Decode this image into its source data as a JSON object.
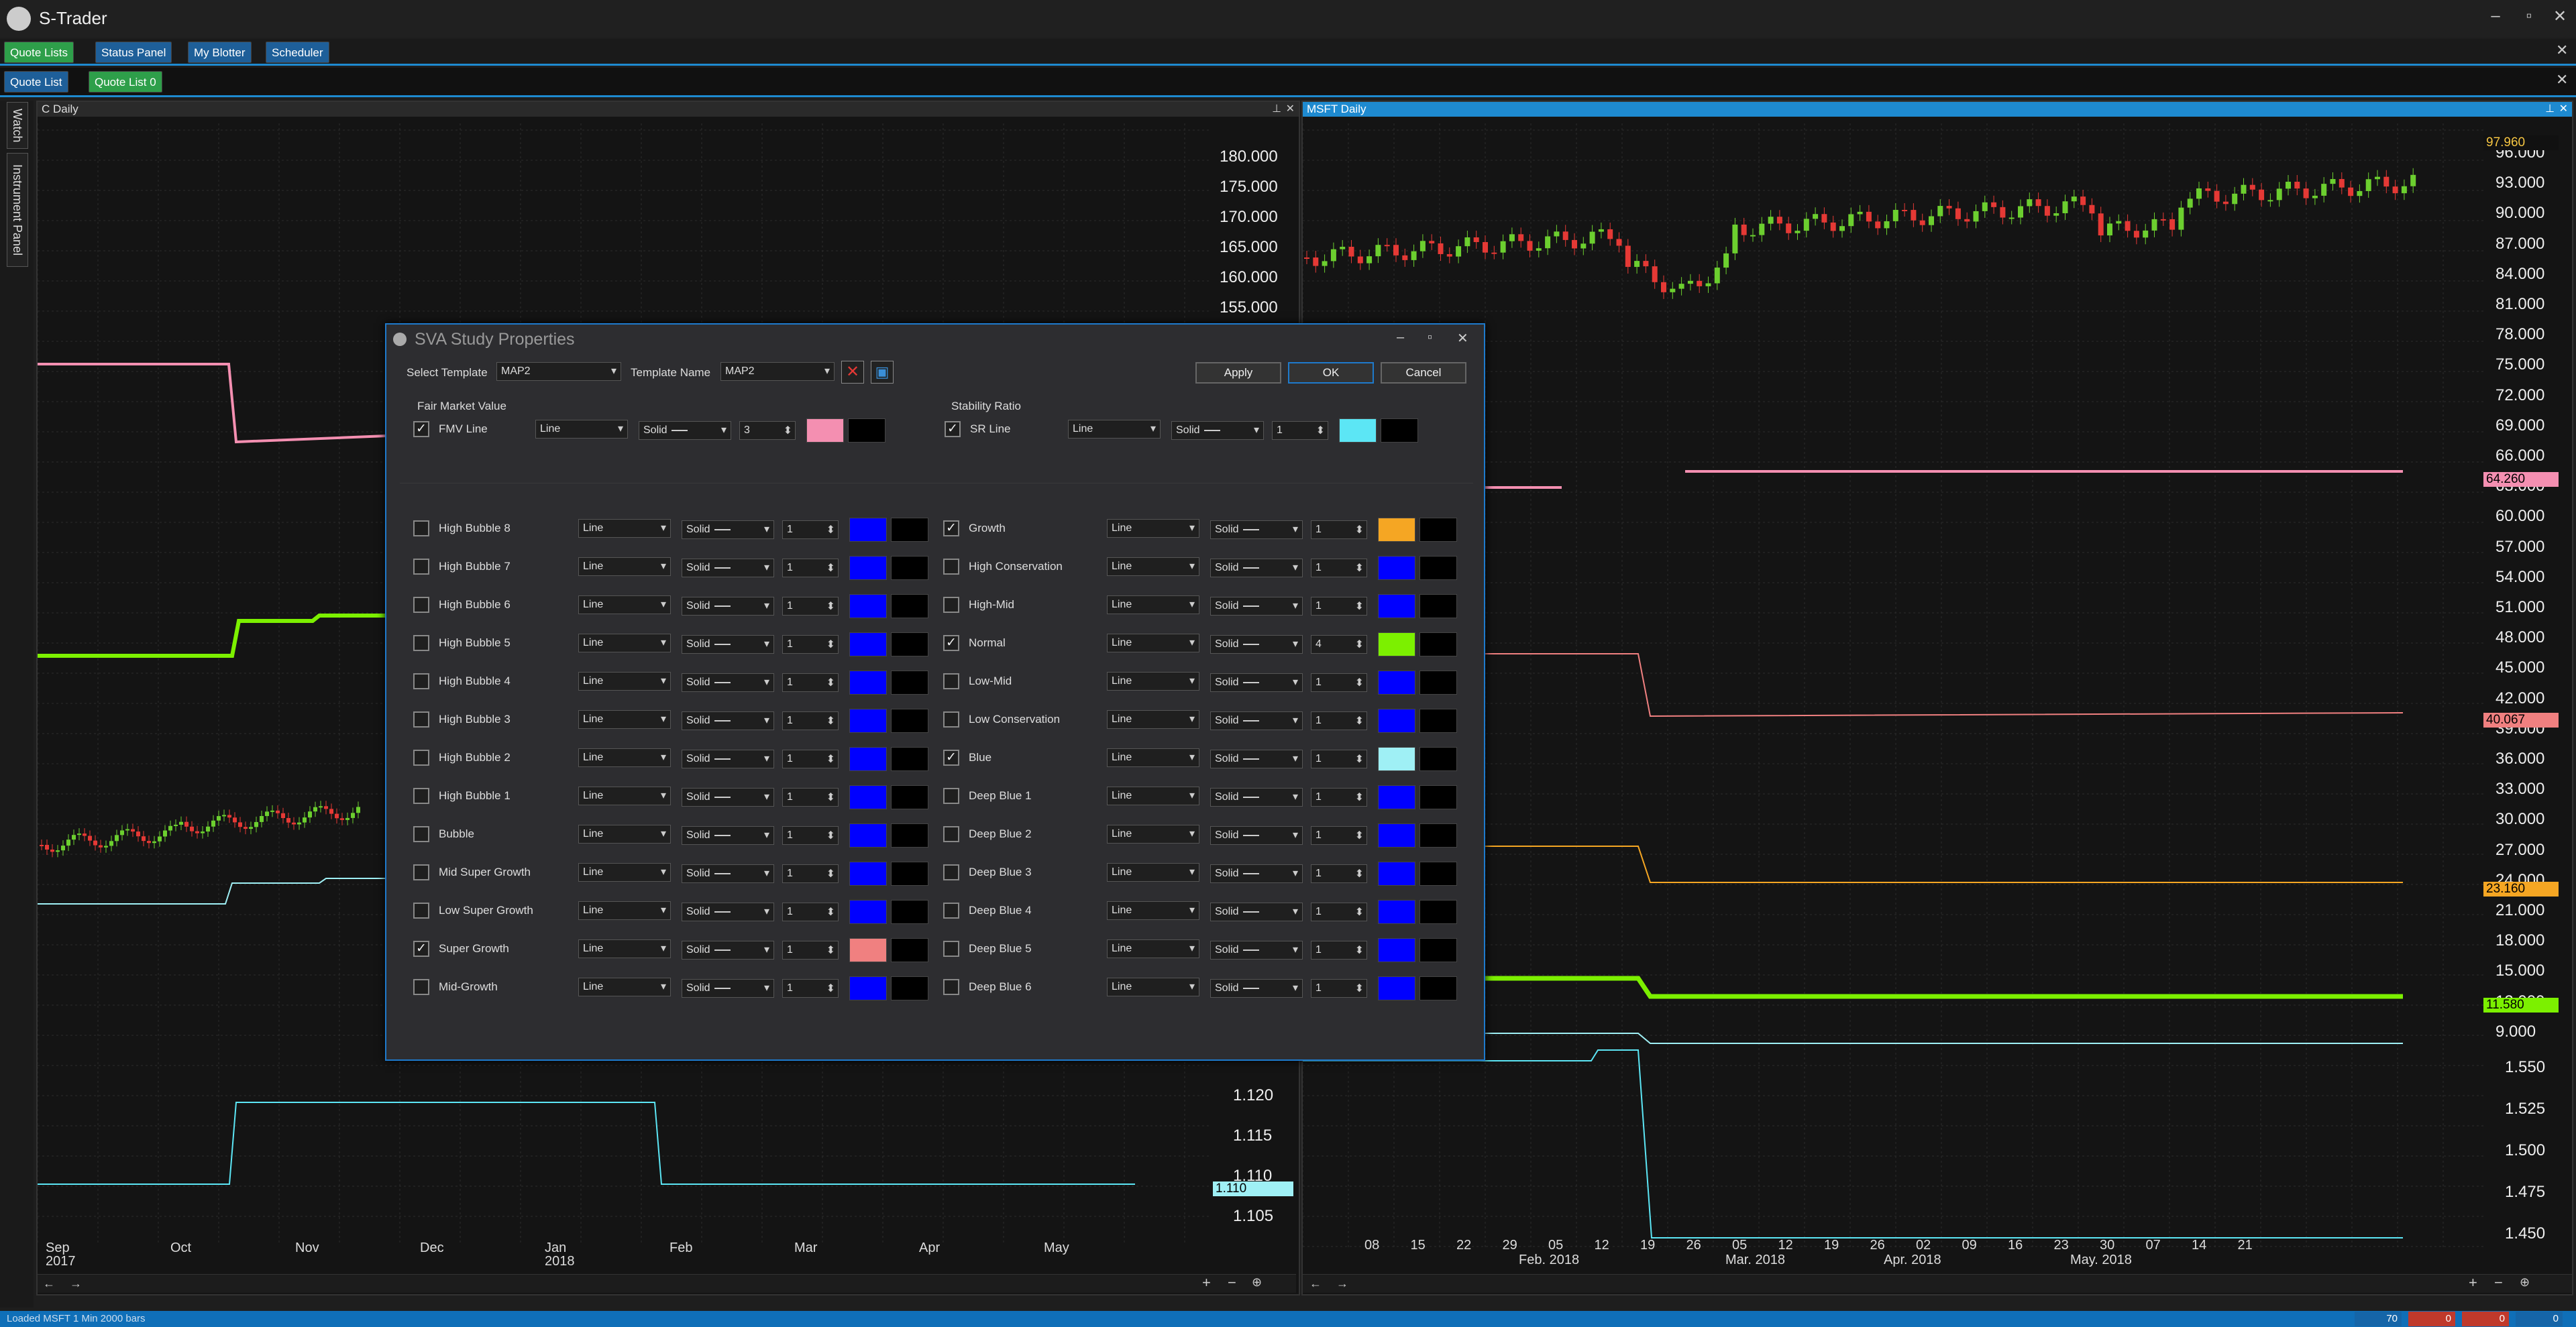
{
  "app": {
    "title": "S-Trader"
  },
  "toolbar": {
    "tabs": [
      "Quote Lists",
      "Status Panel",
      "My Blotter",
      "Scheduler"
    ]
  },
  "subtabs": [
    "Quote List",
    "Quote List 0"
  ],
  "sidebar": [
    "Watch",
    "Instrument Panel"
  ],
  "left_pane": {
    "title": "C Daily",
    "y_upper": [
      "180.000",
      "175.000",
      "170.000",
      "165.000",
      "160.000",
      "155.000"
    ],
    "y_lower": [
      "1.120",
      "1.115",
      "1.110",
      "1.105"
    ],
    "price_tag": "1.110",
    "x_months": [
      {
        "m": "Sep",
        "y": "2017"
      },
      {
        "m": "Oct",
        "y": ""
      },
      {
        "m": "Nov",
        "y": ""
      },
      {
        "m": "Dec",
        "y": ""
      },
      {
        "m": "Jan",
        "y": "2018"
      },
      {
        "m": "Feb",
        "y": ""
      },
      {
        "m": "Mar",
        "y": ""
      },
      {
        "m": "Apr",
        "y": ""
      },
      {
        "m": "May",
        "y": ""
      }
    ]
  },
  "right_pane": {
    "title": "MSFT Daily",
    "y_upper": [
      "96.000",
      "93.000",
      "90.000",
      "87.000",
      "84.000",
      "81.000",
      "78.000",
      "75.000",
      "72.000",
      "69.000",
      "66.000",
      "63.000",
      "60.000",
      "57.000",
      "54.000",
      "51.000",
      "48.000",
      "45.000",
      "42.000",
      "39.000",
      "36.000",
      "33.000",
      "30.000",
      "27.000",
      "24.000",
      "21.000",
      "18.000",
      "15.000",
      "12.000",
      "9.000"
    ],
    "y_lower": [
      "1.550",
      "1.525",
      "1.500",
      "1.475",
      "1.450"
    ],
    "tags": {
      "price": "97.960",
      "pink": "64.260",
      "salmon": "40.067",
      "orange": "23.160",
      "green": "11.580"
    },
    "x_days": [
      "08",
      "15",
      "22",
      "29",
      "05",
      "12",
      "19",
      "26",
      "05",
      "12",
      "19",
      "26",
      "02",
      "09",
      "16",
      "23",
      "30",
      "07",
      "14",
      "21"
    ],
    "x_months": [
      "Feb. 2018",
      "Mar. 2018",
      "Apr. 2018",
      "May. 2018"
    ]
  },
  "status": {
    "text": "Loaded MSFT 1 Min 2000 bars",
    "counters": [
      "70",
      "0",
      "0",
      "0"
    ]
  },
  "dialog": {
    "title": "SVA Study Properties",
    "select_template_label": "Select Template",
    "select_template_value": "MAP2",
    "template_name_label": "Template Name",
    "template_name_value": "MAP2",
    "apply": "Apply",
    "ok": "OK",
    "cancel": "Cancel",
    "fmv_header": "Fair Market Value",
    "sr_header": "Stability Ratio",
    "fmv": {
      "label": "FMV Line",
      "checked": true,
      "type": "Line",
      "style": "Solid",
      "width": "3",
      "color": "#f48fb1"
    },
    "sr": {
      "label": "SR Line",
      "checked": true,
      "type": "Line",
      "style": "Solid",
      "width": "1",
      "color": "#5ce6f5"
    },
    "left_rows": [
      {
        "label": "High Bubble 8",
        "checked": false,
        "type": "Line",
        "style": "Solid",
        "width": "1",
        "color": "#0000ff"
      },
      {
        "label": "High Bubble 7",
        "checked": false,
        "type": "Line",
        "style": "Solid",
        "width": "1",
        "color": "#0000ff"
      },
      {
        "label": "High Bubble 6",
        "checked": false,
        "type": "Line",
        "style": "Solid",
        "width": "1",
        "color": "#0000ff"
      },
      {
        "label": "High Bubble 5",
        "checked": false,
        "type": "Line",
        "style": "Solid",
        "width": "1",
        "color": "#0000ff"
      },
      {
        "label": "High Bubble 4",
        "checked": false,
        "type": "Line",
        "style": "Solid",
        "width": "1",
        "color": "#0000ff"
      },
      {
        "label": "High Bubble 3",
        "checked": false,
        "type": "Line",
        "style": "Solid",
        "width": "1",
        "color": "#0000ff"
      },
      {
        "label": "High Bubble 2",
        "checked": false,
        "type": "Line",
        "style": "Solid",
        "width": "1",
        "color": "#0000ff"
      },
      {
        "label": "High Bubble 1",
        "checked": false,
        "type": "Line",
        "style": "Solid",
        "width": "1",
        "color": "#0000ff"
      },
      {
        "label": "Bubble",
        "checked": false,
        "type": "Line",
        "style": "Solid",
        "width": "1",
        "color": "#0000ff"
      },
      {
        "label": "Mid Super Growth",
        "checked": false,
        "type": "Line",
        "style": "Solid",
        "width": "1",
        "color": "#0000ff"
      },
      {
        "label": "Low Super Growth",
        "checked": false,
        "type": "Line",
        "style": "Solid",
        "width": "1",
        "color": "#0000ff"
      },
      {
        "label": "Super Growth",
        "checked": true,
        "type": "Line",
        "style": "Solid",
        "width": "1",
        "color": "#f08080"
      },
      {
        "label": "Mid-Growth",
        "checked": false,
        "type": "Line",
        "style": "Solid",
        "width": "1",
        "color": "#0000ff"
      }
    ],
    "right_rows": [
      {
        "label": "Growth",
        "checked": true,
        "type": "Line",
        "style": "Solid",
        "width": "1",
        "color": "#f5a623"
      },
      {
        "label": "High Conservation",
        "checked": false,
        "type": "Line",
        "style": "Solid",
        "width": "1",
        "color": "#0000ff"
      },
      {
        "label": "High-Mid",
        "checked": false,
        "type": "Line",
        "style": "Solid",
        "width": "1",
        "color": "#0000ff"
      },
      {
        "label": "Normal",
        "checked": true,
        "type": "Line",
        "style": "Solid",
        "width": "4",
        "color": "#7cf000"
      },
      {
        "label": "Low-Mid",
        "checked": false,
        "type": "Line",
        "style": "Solid",
        "width": "1",
        "color": "#0000ff"
      },
      {
        "label": "Low Conservation",
        "checked": false,
        "type": "Line",
        "style": "Solid",
        "width": "1",
        "color": "#0000ff"
      },
      {
        "label": "Blue",
        "checked": true,
        "type": "Line",
        "style": "Solid",
        "width": "1",
        "color": "#9ff0f5"
      },
      {
        "label": "Deep Blue 1",
        "checked": false,
        "type": "Line",
        "style": "Solid",
        "width": "1",
        "color": "#0000ff"
      },
      {
        "label": "Deep Blue 2",
        "checked": false,
        "type": "Line",
        "style": "Solid",
        "width": "1",
        "color": "#0000ff"
      },
      {
        "label": "Deep Blue 3",
        "checked": false,
        "type": "Line",
        "style": "Solid",
        "width": "1",
        "color": "#0000ff"
      },
      {
        "label": "Deep Blue 4",
        "checked": false,
        "type": "Line",
        "style": "Solid",
        "width": "1",
        "color": "#0000ff"
      },
      {
        "label": "Deep Blue 5",
        "checked": false,
        "type": "Line",
        "style": "Solid",
        "width": "1",
        "color": "#0000ff"
      },
      {
        "label": "Deep Blue 6",
        "checked": false,
        "type": "Line",
        "style": "Solid",
        "width": "1",
        "color": "#0000ff"
      }
    ]
  }
}
